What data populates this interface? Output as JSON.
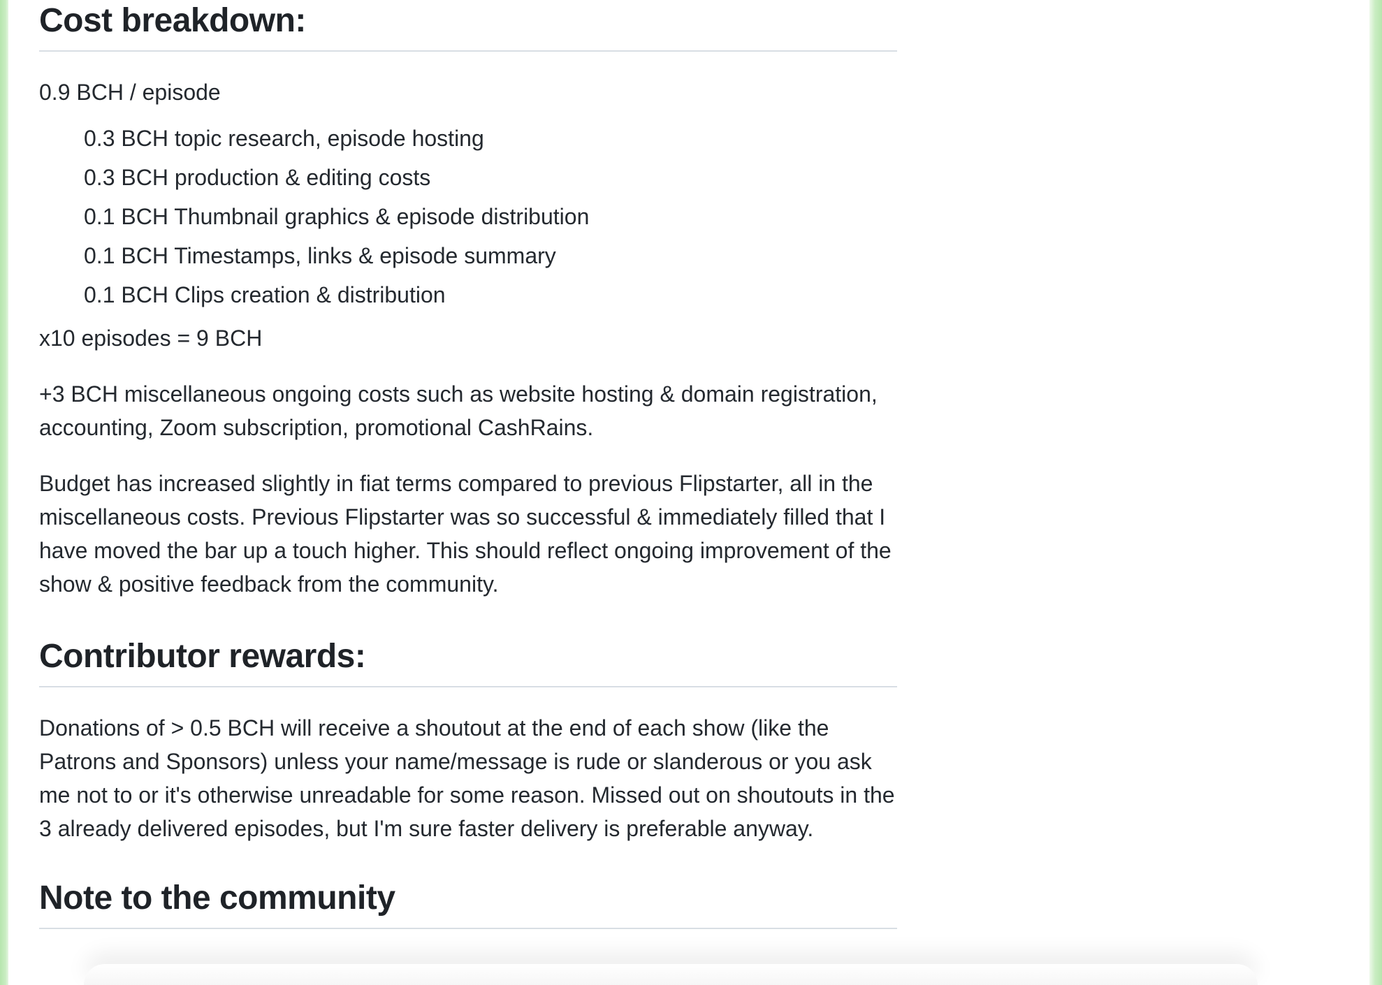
{
  "sections": {
    "cost": {
      "heading": "Cost breakdown:",
      "per_episode": "0.9 BCH / episode",
      "items": [
        "0.3 BCH topic research, episode hosting",
        "0.3 BCH production & editing costs",
        "0.1 BCH Thumbnail graphics & episode distribution",
        "0.1 BCH Timestamps, links & episode summary",
        "0.1 BCH Clips creation & distribution"
      ],
      "total": "x10 episodes = 9 BCH",
      "misc": "+3 BCH miscellaneous ongoing costs such as website hosting & domain registration, accounting, Zoom subscription, promotional CashRains.",
      "budget": "Budget has increased slightly in fiat terms compared to previous Flipstarter, all in the miscellaneous costs. Previous Flipstarter was so successful & immediately filled that I have moved the bar up a touch higher. This should reflect ongoing improvement of the show & positive feedback from the community."
    },
    "rewards": {
      "heading": "Contributor rewards:",
      "text": "Donations of > 0.5 BCH will receive a shoutout at the end of each show (like the Patrons and Sponsors) unless your name/message is rude or slanderous or you ask me not to or it's otherwise unreadable for some reason. Missed out on shoutouts in the 3 already delivered episodes, but I'm sure faster delivery is preferable anyway."
    },
    "note": {
      "heading": "Note to the community"
    }
  }
}
